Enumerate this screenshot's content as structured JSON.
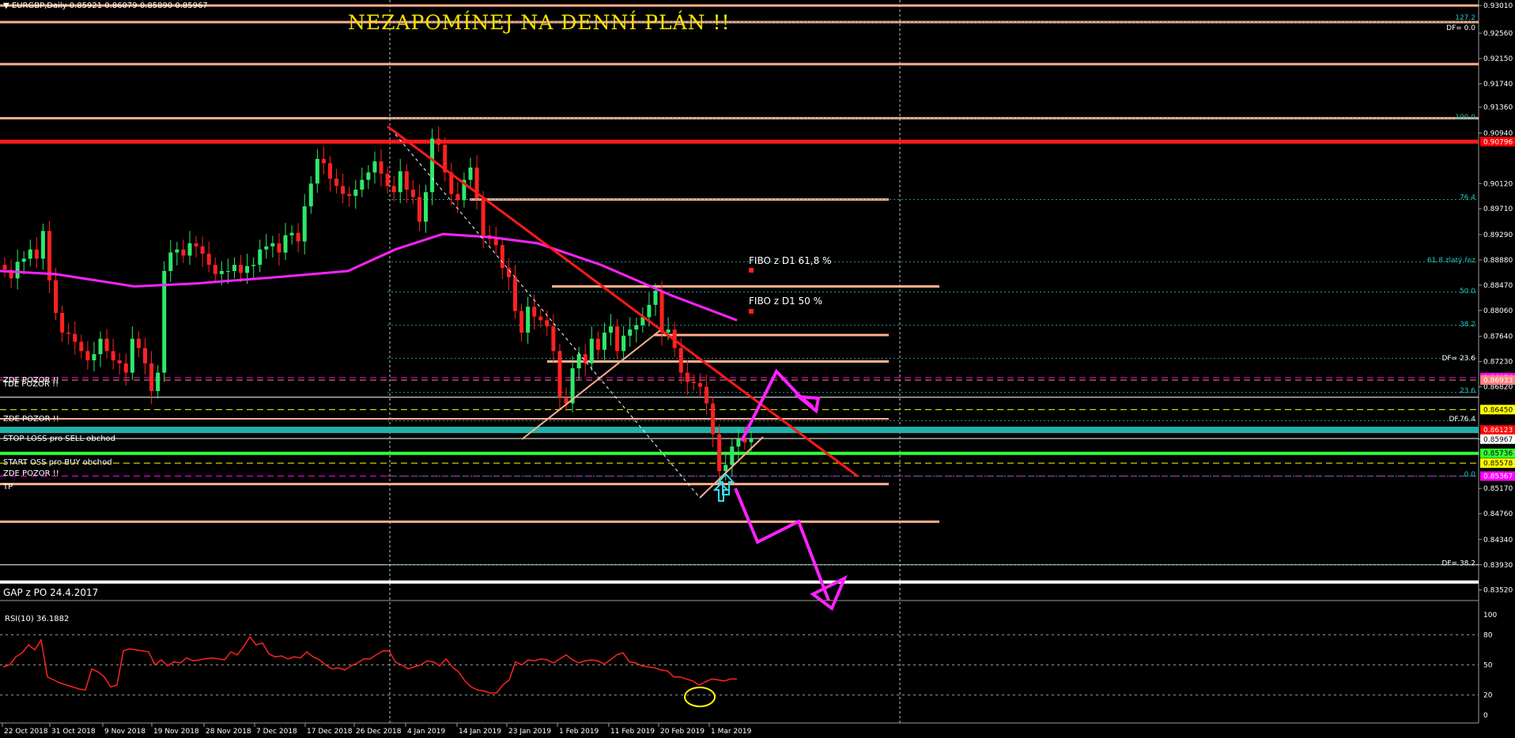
{
  "header": {
    "symbol_menu": "▼ EURGBP,Daily  0.85921 0.86079 0.85890 0.85967"
  },
  "banner": "NEZAPOMÍNEJ  NA  DENNÍ  PLÁN !!",
  "annotations": {
    "zde_pozor_1": "ZDE POZOR !!",
    "tde_pozor": "TDE POZOR !!",
    "zde_pozor_2": "ZDE POZOR !!",
    "stop_loss": "STOP-LOSS pro SELL obchod",
    "start_loss": "START OSS pro BUY obchod",
    "zde_pozor_3": "ZDE POZOR !!",
    "tp": "TP",
    "gap": "GAP z PO 24.4.2017",
    "fibo_618": "FIBO z D1 61,8 %",
    "fibo_50": "FIBO z D1 50 %"
  },
  "price_scale": {
    "labels": [
      "0.93010",
      "0.92560",
      "0.92150",
      "0.91740",
      "0.91360",
      "0.90940",
      "0.90120",
      "0.89710",
      "0.89290",
      "0.88880",
      "0.88470",
      "0.88060",
      "0.87640",
      "0.87230",
      "0.86820",
      "0.85967",
      "0.85170",
      "0.84760",
      "0.84340",
      "0.83930",
      "0.83520"
    ],
    "ylim": [
      0.8335,
      0.931
    ]
  },
  "price_tags": [
    {
      "text": "0.90796",
      "bg": "#ff0000",
      "fg": "#ffffff"
    },
    {
      "text": "0.86974",
      "bg": "#ff00ff",
      "fg": "#ffffff"
    },
    {
      "text": "0.86933",
      "bg": "#ff8080",
      "fg": "#ffffff"
    },
    {
      "text": "0.86450",
      "bg": "#ffff00",
      "fg": "#000000"
    },
    {
      "text": "0.86123",
      "bg": "#ff0000",
      "fg": "#ffffff"
    },
    {
      "text": "0.85967",
      "bg": "#ffffff",
      "fg": "#000000"
    },
    {
      "text": "0.85736",
      "bg": "#33ff33",
      "fg": "#000000"
    },
    {
      "text": "0.85578",
      "bg": "#ffff00",
      "fg": "#000000"
    },
    {
      "text": "0.85367",
      "bg": "#ff00ff",
      "fg": "#ffffff"
    }
  ],
  "fib_labels": {
    "f127": "127.2",
    "df0": "DF= 0.0",
    "f100": "100.0",
    "f764": "76.4",
    "f618": "61.8 zlatý řez",
    "f50": "50.0",
    "f382": "38.2",
    "df236": "DF= 23.6",
    "f236": "23.6",
    "df764": "DF.76.4",
    "f0": "0.0",
    "df382": "DF= 38.2"
  },
  "rsi": {
    "title": "RSI(10) 36.1882",
    "scale": [
      "100",
      "80",
      "50",
      "20",
      "0"
    ],
    "levels": [
      80,
      50,
      20
    ],
    "values": [
      48,
      50,
      58,
      62,
      70,
      65,
      75,
      38,
      35,
      32,
      30,
      28,
      26,
      25,
      46,
      43,
      38,
      28,
      30,
      64,
      66,
      65,
      64,
      63,
      50,
      55,
      49,
      53,
      52,
      57,
      54,
      55,
      56,
      57,
      56,
      55,
      63,
      60,
      68,
      78,
      70,
      72,
      61,
      58,
      59,
      56,
      58,
      57,
      63,
      58,
      55,
      50,
      46,
      47,
      45,
      49,
      52,
      56,
      56,
      60,
      64,
      64,
      53,
      50,
      46,
      48,
      50,
      54,
      53,
      49,
      56,
      48,
      43,
      34,
      28,
      25,
      24,
      22,
      22,
      30,
      35,
      53,
      50,
      55,
      54,
      56,
      55,
      52,
      56,
      60,
      55,
      52,
      54,
      55,
      54,
      51,
      55,
      60,
      62,
      53,
      52,
      49,
      48,
      47,
      45,
      44,
      38,
      38,
      36,
      34,
      30,
      33,
      36,
      35,
      34,
      36,
      36
    ]
  },
  "x_axis": {
    "labels": [
      "22 Oct 2018",
      "31 Oct 2018",
      "9 Nov 2018",
      "19 Nov 2018",
      "28 Nov 2018",
      "7 Dec 2018",
      "17 Dec 2018",
      "26 Dec 2018",
      "4 Jan 2019",
      "14 Jan 2019",
      "23 Jan 2019",
      "1 Feb 2019",
      "11 Feb 2019",
      "20 Feb 2019",
      "1 Mar 2019"
    ]
  },
  "chart_data": {
    "type": "candlestick",
    "symbol": "EURGBP",
    "timeframe": "Daily",
    "ohlc_last": {
      "open": 0.85921,
      "high": 0.86079,
      "low": 0.8589,
      "close": 0.85967
    },
    "close_series": [
      0.8872,
      0.8858,
      0.8885,
      0.889,
      0.8905,
      0.889,
      0.8935,
      0.8855,
      0.8802,
      0.877,
      0.8768,
      0.8755,
      0.874,
      0.8725,
      0.8735,
      0.876,
      0.874,
      0.8725,
      0.872,
      0.8705,
      0.876,
      0.8745,
      0.872,
      0.8675,
      0.8705,
      0.887,
      0.89,
      0.8905,
      0.8895,
      0.8915,
      0.891,
      0.8898,
      0.888,
      0.8865,
      0.887,
      0.887,
      0.888,
      0.8867,
      0.8878,
      0.888,
      0.8905,
      0.891,
      0.8915,
      0.89,
      0.8928,
      0.8932,
      0.8918,
      0.8975,
      0.9012,
      0.9052,
      0.9045,
      0.902,
      0.9008,
      0.8995,
      0.8992,
      0.9002,
      0.9018,
      0.903,
      0.9048,
      0.9028,
      0.9008,
      0.8998,
      0.9032,
      0.9002,
      0.899,
      0.895,
      0.8998,
      0.9085,
      0.9075,
      0.903,
      0.8995,
      0.8985,
      0.9018,
      0.9038,
      0.8988,
      0.8928,
      0.8922,
      0.8912,
      0.8875,
      0.886,
      0.8805,
      0.877,
      0.8812,
      0.8796,
      0.879,
      0.878,
      0.874,
      0.8665,
      0.8655,
      0.8712,
      0.8735,
      0.872,
      0.876,
      0.8742,
      0.877,
      0.878,
      0.874,
      0.8765,
      0.8775,
      0.8782,
      0.8795,
      0.8815,
      0.8838,
      0.877,
      0.8775,
      0.8745,
      0.8705,
      0.869,
      0.8688,
      0.8682,
      0.8655,
      0.8605,
      0.8545,
      0.8555,
      0.8585,
      0.8597,
      0.8592,
      0.8597
    ],
    "moving_average_points": [
      0.887,
      0.8865,
      0.8845,
      0.885,
      0.886,
      0.887,
      0.8905,
      0.893,
      0.8925,
      0.8915,
      0.888,
      0.883,
      0.879
    ],
    "horizontal_levels": [
      0.9301,
      0.9274,
      0.9206,
      0.9118,
      0.908,
      0.8986,
      0.8845,
      0.8766,
      0.8723,
      0.8697,
      0.8693,
      0.8665,
      0.8645,
      0.863,
      0.8612,
      0.8598,
      0.8574,
      0.8558,
      0.8537,
      0.8524,
      0.8463,
      0.8393,
      0.8365
    ],
    "rsi_period": 10,
    "rsi_value": 36.1882
  }
}
